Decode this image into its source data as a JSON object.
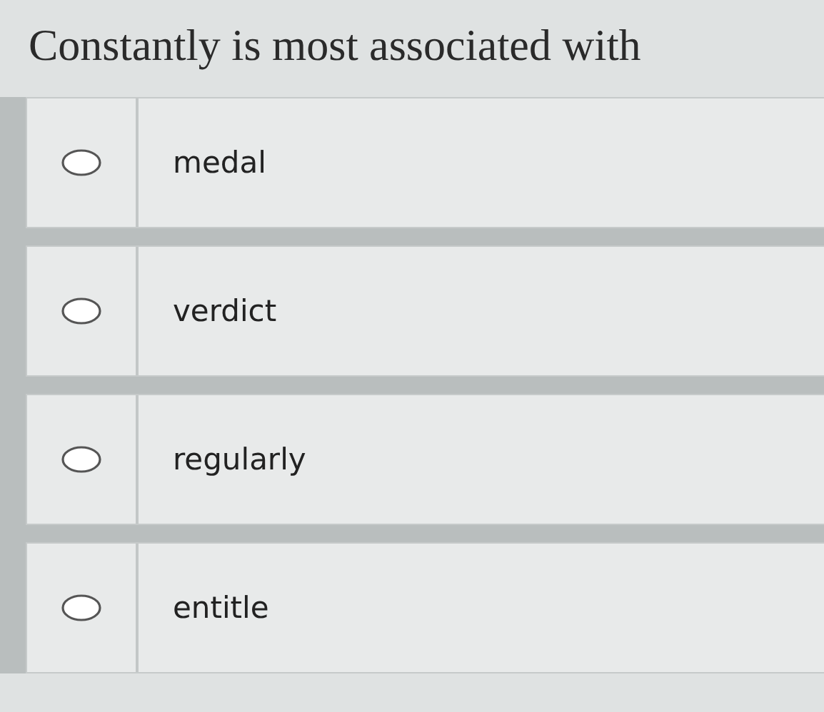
{
  "question": "Constantly is most associated with",
  "options": [
    {
      "label": "medal",
      "selected": false
    },
    {
      "label": "verdict",
      "selected": false
    },
    {
      "label": "regularly",
      "selected": false
    },
    {
      "label": "entitle",
      "selected": false
    }
  ]
}
